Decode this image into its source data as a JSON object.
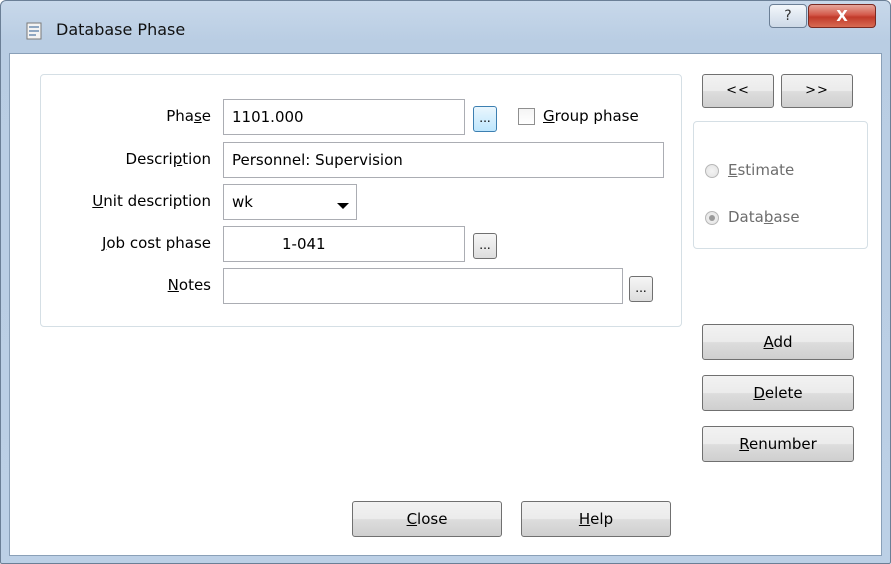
{
  "window": {
    "title": "Database Phase",
    "help_label": "?",
    "close_label": "X"
  },
  "form": {
    "phase": {
      "label_pre": "Pha",
      "label_key": "s",
      "label_post": "e",
      "value": "1101.000"
    },
    "group_phase": {
      "label_key": "G",
      "label_post": "roup phase",
      "checked": false
    },
    "description": {
      "label_pre": "Descri",
      "label_key": "p",
      "label_post": "tion",
      "value": "Personnel: Supervision"
    },
    "unit_description": {
      "label_key": "U",
      "label_post": "nit description",
      "value": "wk"
    },
    "job_cost_phase": {
      "label_key": "J",
      "label_post": "ob cost phase",
      "value": "1-041"
    },
    "notes": {
      "label_key": "N",
      "label_post": "otes",
      "value": ""
    },
    "ellipsis_label": "..."
  },
  "nav": {
    "prev_label": "<<",
    "next_label": ">>"
  },
  "mode": {
    "estimate": {
      "label_key": "E",
      "label_post": "stimate",
      "selected": false
    },
    "database": {
      "label_pre": "Data",
      "label_key": "b",
      "label_post": "ase",
      "selected": true
    }
  },
  "actions": {
    "add": {
      "label_key": "A",
      "label_post": "dd"
    },
    "delete": {
      "label_key": "D",
      "label_post": "elete"
    },
    "renumber": {
      "label_key": "R",
      "label_post": "enumber"
    }
  },
  "footer": {
    "close": {
      "label_key": "C",
      "label_post": "lose"
    },
    "help": {
      "label_key": "H",
      "label_post": "elp"
    }
  }
}
